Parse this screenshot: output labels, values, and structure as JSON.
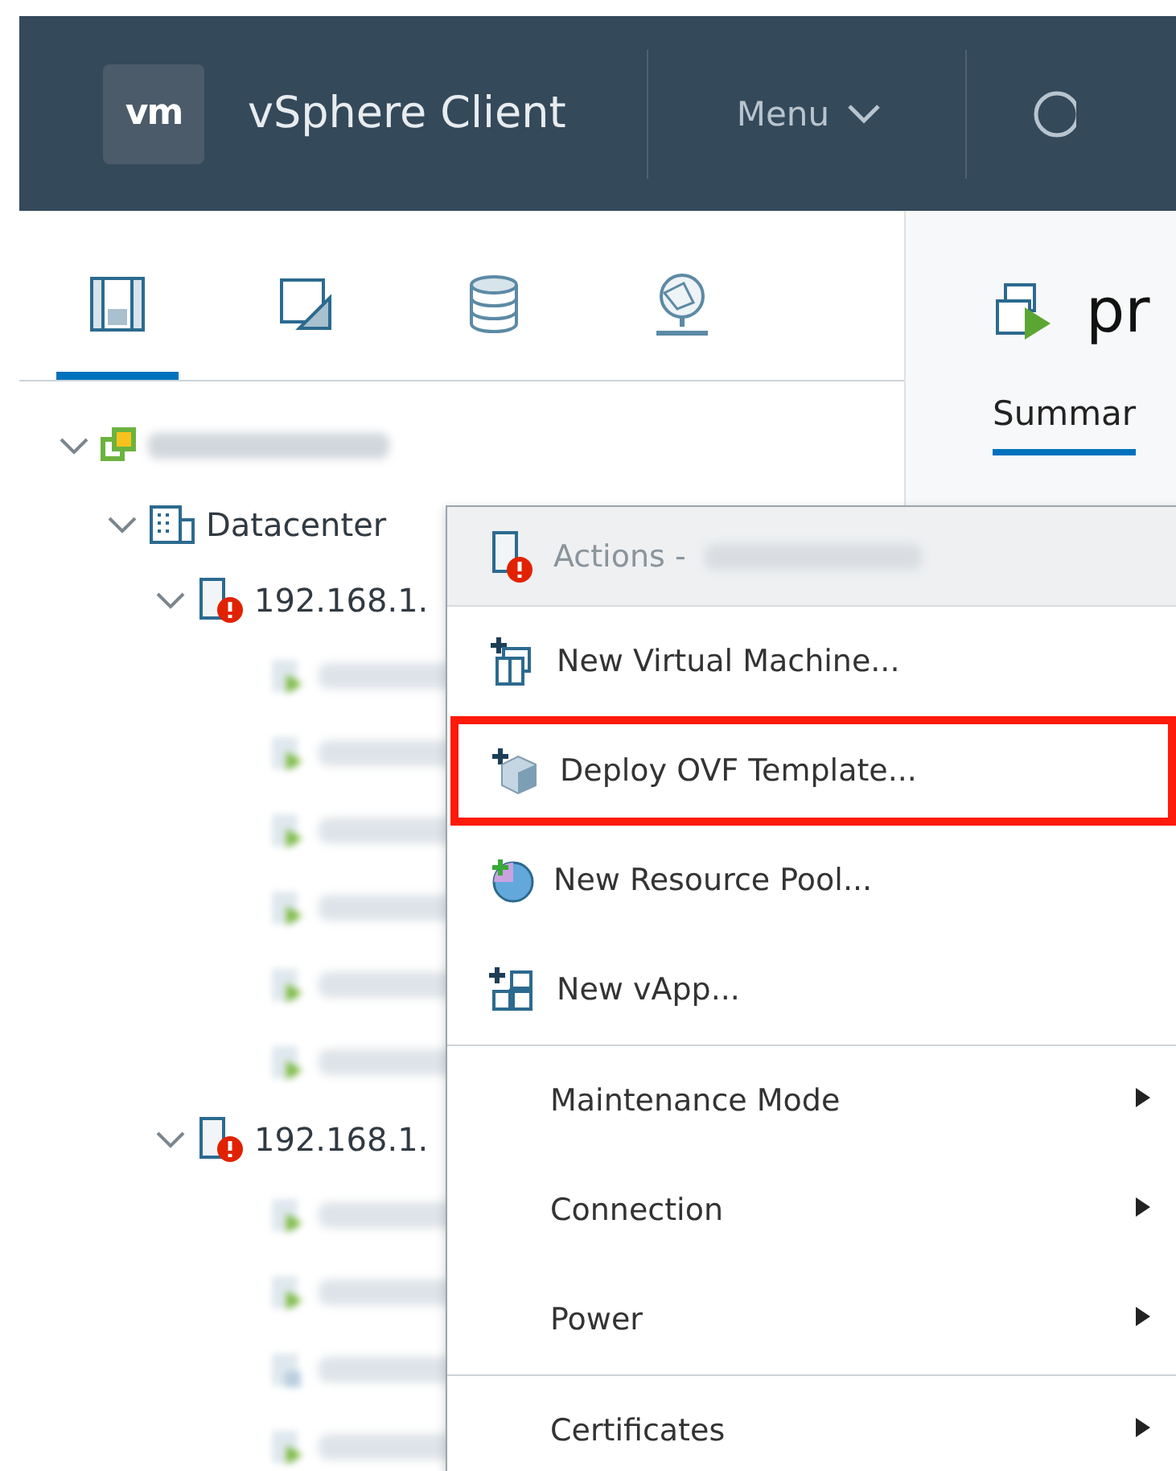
{
  "header": {
    "logo": "vm",
    "title": "vSphere Client",
    "menu": "Menu"
  },
  "nav_tabs": [
    {
      "selected": true
    },
    {
      "selected": false
    },
    {
      "selected": false
    },
    {
      "selected": false
    }
  ],
  "tree": [
    {
      "kind": "vcenter",
      "children": [
        {
          "kind": "datacenter",
          "label": "Datacenter",
          "children": [
            {
              "kind": "host",
              "label": "192.168.1.",
              "alert": true,
              "children": [
                {
                  "kind": "vm",
                  "powered_on": true
                },
                {
                  "kind": "vm",
                  "powered_on": true
                },
                {
                  "kind": "vm",
                  "powered_on": true
                },
                {
                  "kind": "vm",
                  "powered_on": true
                },
                {
                  "kind": "vm",
                  "powered_on": true
                },
                {
                  "kind": "vm",
                  "powered_on": true
                }
              ]
            },
            {
              "kind": "host",
              "label": "192.168.1.",
              "alert": true,
              "children": [
                {
                  "kind": "vm",
                  "powered_on": true
                },
                {
                  "kind": "vm",
                  "powered_on": true
                },
                {
                  "kind": "vm",
                  "powered_on": false
                },
                {
                  "kind": "vm",
                  "powered_on": true
                }
              ]
            }
          ]
        }
      ]
    }
  ],
  "content": {
    "title": "pr",
    "tabs": [
      {
        "label": "Summar",
        "selected": true
      }
    ]
  },
  "context_menu": {
    "title": "Actions -",
    "sections": [
      [
        {
          "kind": "action",
          "label": "New Virtual Machine...",
          "highlighted": false
        },
        {
          "kind": "action",
          "label": "Deploy OVF Template...",
          "highlighted": true
        },
        {
          "kind": "action",
          "label": "New Resource Pool...",
          "highlighted": false
        },
        {
          "kind": "action",
          "label": "New vApp...",
          "highlighted": false
        }
      ],
      [
        {
          "kind": "submenu",
          "label": "Maintenance Mode"
        },
        {
          "kind": "submenu",
          "label": "Connection"
        },
        {
          "kind": "submenu",
          "label": "Power"
        }
      ],
      [
        {
          "kind": "submenu",
          "label": "Certificates"
        }
      ]
    ]
  }
}
